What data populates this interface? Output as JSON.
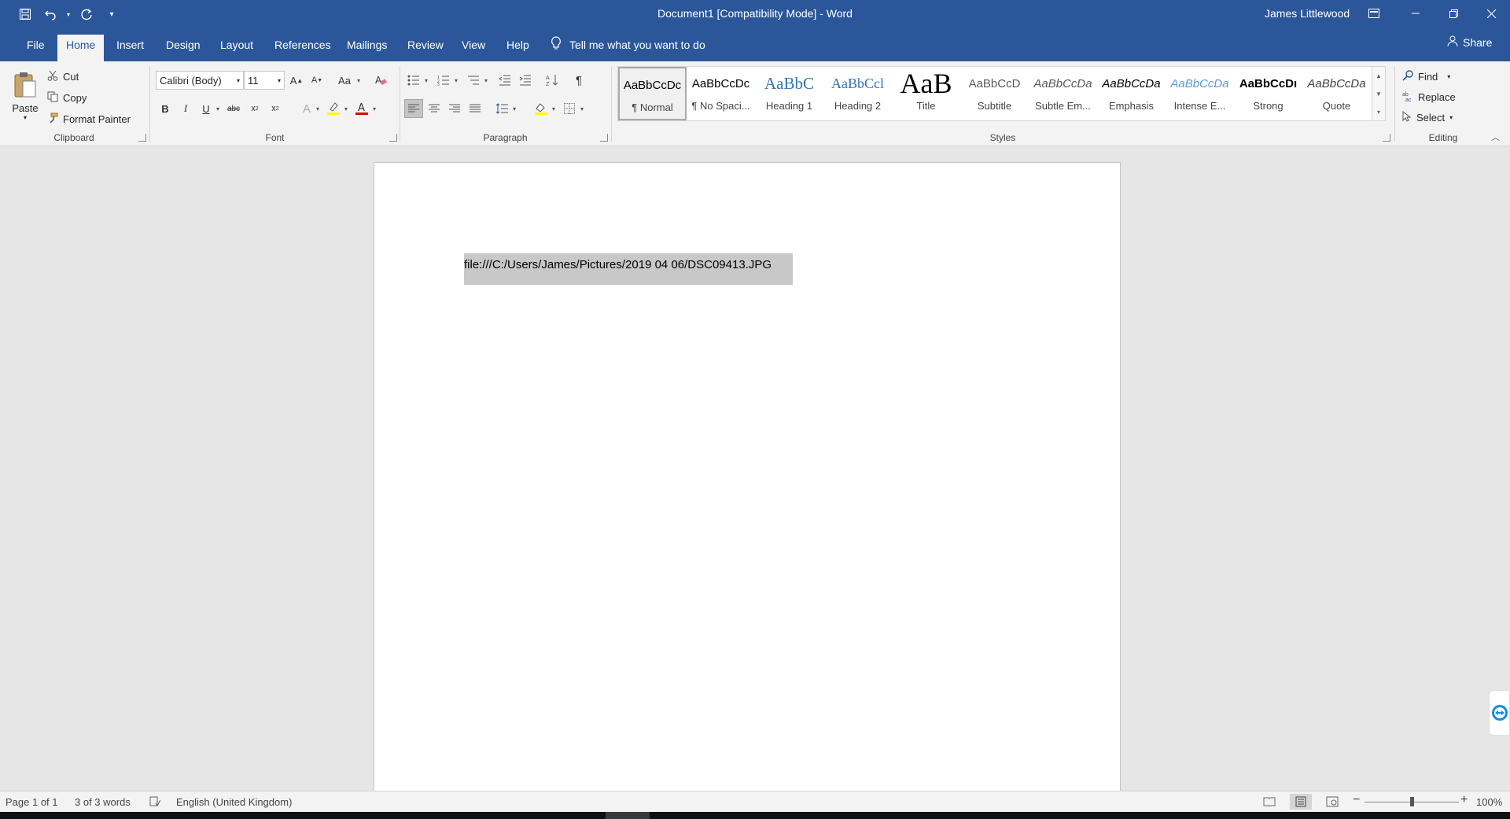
{
  "title_bar": {
    "document_title": "Document1 [Compatibility Mode]  -  Word",
    "user_name": "James Littlewood"
  },
  "tabs": [
    "File",
    "Home",
    "Insert",
    "Design",
    "Layout",
    "References",
    "Mailings",
    "Review",
    "View",
    "Help"
  ],
  "active_tab": "Home",
  "tell_me": "Tell me what you want to do",
  "share": "Share",
  "clipboard": {
    "paste": "Paste",
    "cut": "Cut",
    "copy": "Copy",
    "format_painter": "Format Painter",
    "group_label": "Clipboard"
  },
  "font": {
    "name": "Calibri (Body)",
    "size": "11",
    "change_case": "Aa",
    "group_label": "Font"
  },
  "paragraph": {
    "group_label": "Paragraph"
  },
  "styles": {
    "group_label": "Styles",
    "items": [
      {
        "preview": "AaBbCcDc",
        "label": "¶ Normal"
      },
      {
        "preview": "AaBbCcDc",
        "label": "¶ No Spaci..."
      },
      {
        "preview": "AaBbC",
        "label": "Heading 1"
      },
      {
        "preview": "AaBbCcl",
        "label": "Heading 2"
      },
      {
        "preview": "AaB",
        "label": "Title"
      },
      {
        "preview": "AaBbCcD",
        "label": "Subtitle"
      },
      {
        "preview": "AaBbCcDa",
        "label": "Subtle Em..."
      },
      {
        "preview": "AaBbCcDa",
        "label": "Emphasis"
      },
      {
        "preview": "AaBbCcDa",
        "label": "Intense E..."
      },
      {
        "preview": "AaBbCcDı",
        "label": "Strong"
      },
      {
        "preview": "AaBbCcDa",
        "label": "Quote"
      }
    ]
  },
  "editing": {
    "find": "Find",
    "replace": "Replace",
    "select": "Select",
    "group_label": "Editing"
  },
  "document": {
    "content": "file:///C:/Users/James/Pictures/2019 04 06/DSC09413.JPG"
  },
  "status": {
    "page": "Page 1 of 1",
    "words": "3 of 3 words",
    "language": "English (United Kingdom)",
    "zoom": "100%",
    "zoom_value": 100
  },
  "colors": {
    "word_blue": "#2b579a",
    "ribbon": "#f3f3f3",
    "selection": "#c8c8c8",
    "font_color_underline": "#e00000",
    "highlight_yellow": "#ffff00"
  }
}
